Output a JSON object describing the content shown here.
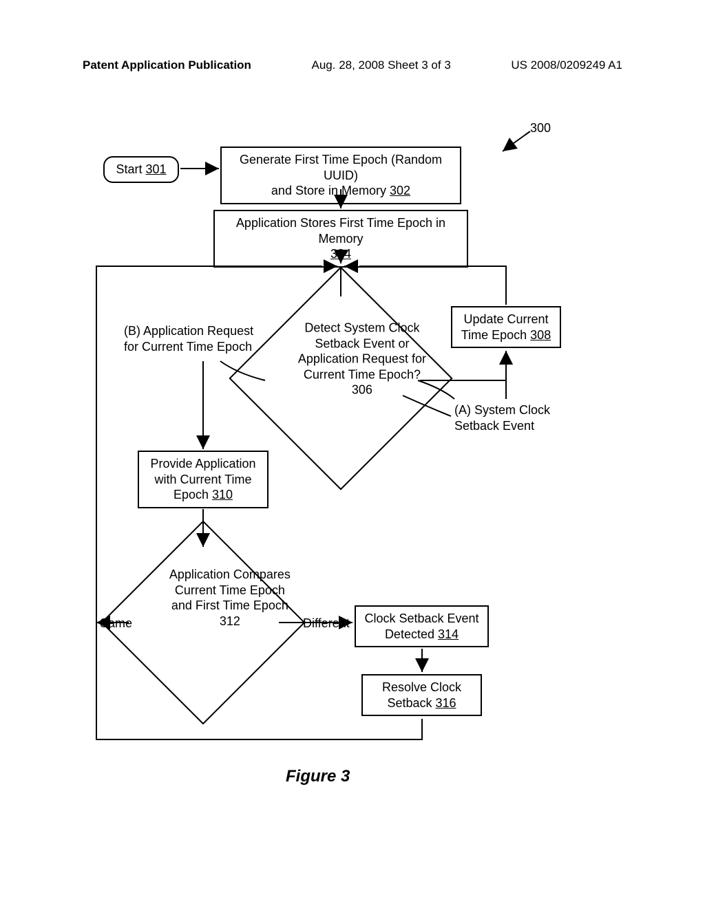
{
  "header": {
    "left": "Patent Application Publication",
    "mid": "Aug. 28, 2008  Sheet 3 of 3",
    "right": "US 2008/0209249 A1"
  },
  "ref": {
    "r300": "300",
    "start": "Start",
    "r301": "301",
    "box302a": "Generate First Time Epoch (Random UUID)",
    "box302b": "and Store in Memory",
    "r302": "302",
    "box304a": "Application Stores First Time Epoch in Memory",
    "r304": "304",
    "dec306a": "Detect System Clock",
    "dec306b": "Setback Event or",
    "dec306c": "Application Request for",
    "dec306d": "Current Time Epoch?",
    "r306": "306",
    "labelB1": "(B)  Application Request",
    "labelB2": "for Current Time Epoch",
    "labelA1": "(A)  System Clock",
    "labelA2": "Setback Event",
    "box308a": "Update Current",
    "box308b": "Time Epoch",
    "r308": "308",
    "box310a": "Provide Application",
    "box310b": "with Current Time",
    "box310c": "Epoch",
    "r310": "310",
    "dec312a": "Application Compares",
    "dec312b": "Current Time Epoch",
    "dec312c": "and First Time Epoch",
    "r312": "312",
    "same": "Same",
    "diff": "Different",
    "box314a": "Clock Setback Event",
    "box314b": "Detected",
    "r314": "314",
    "box316a": "Resolve Clock",
    "box316b": "Setback",
    "r316": "316",
    "figcap": "Figure 3"
  }
}
